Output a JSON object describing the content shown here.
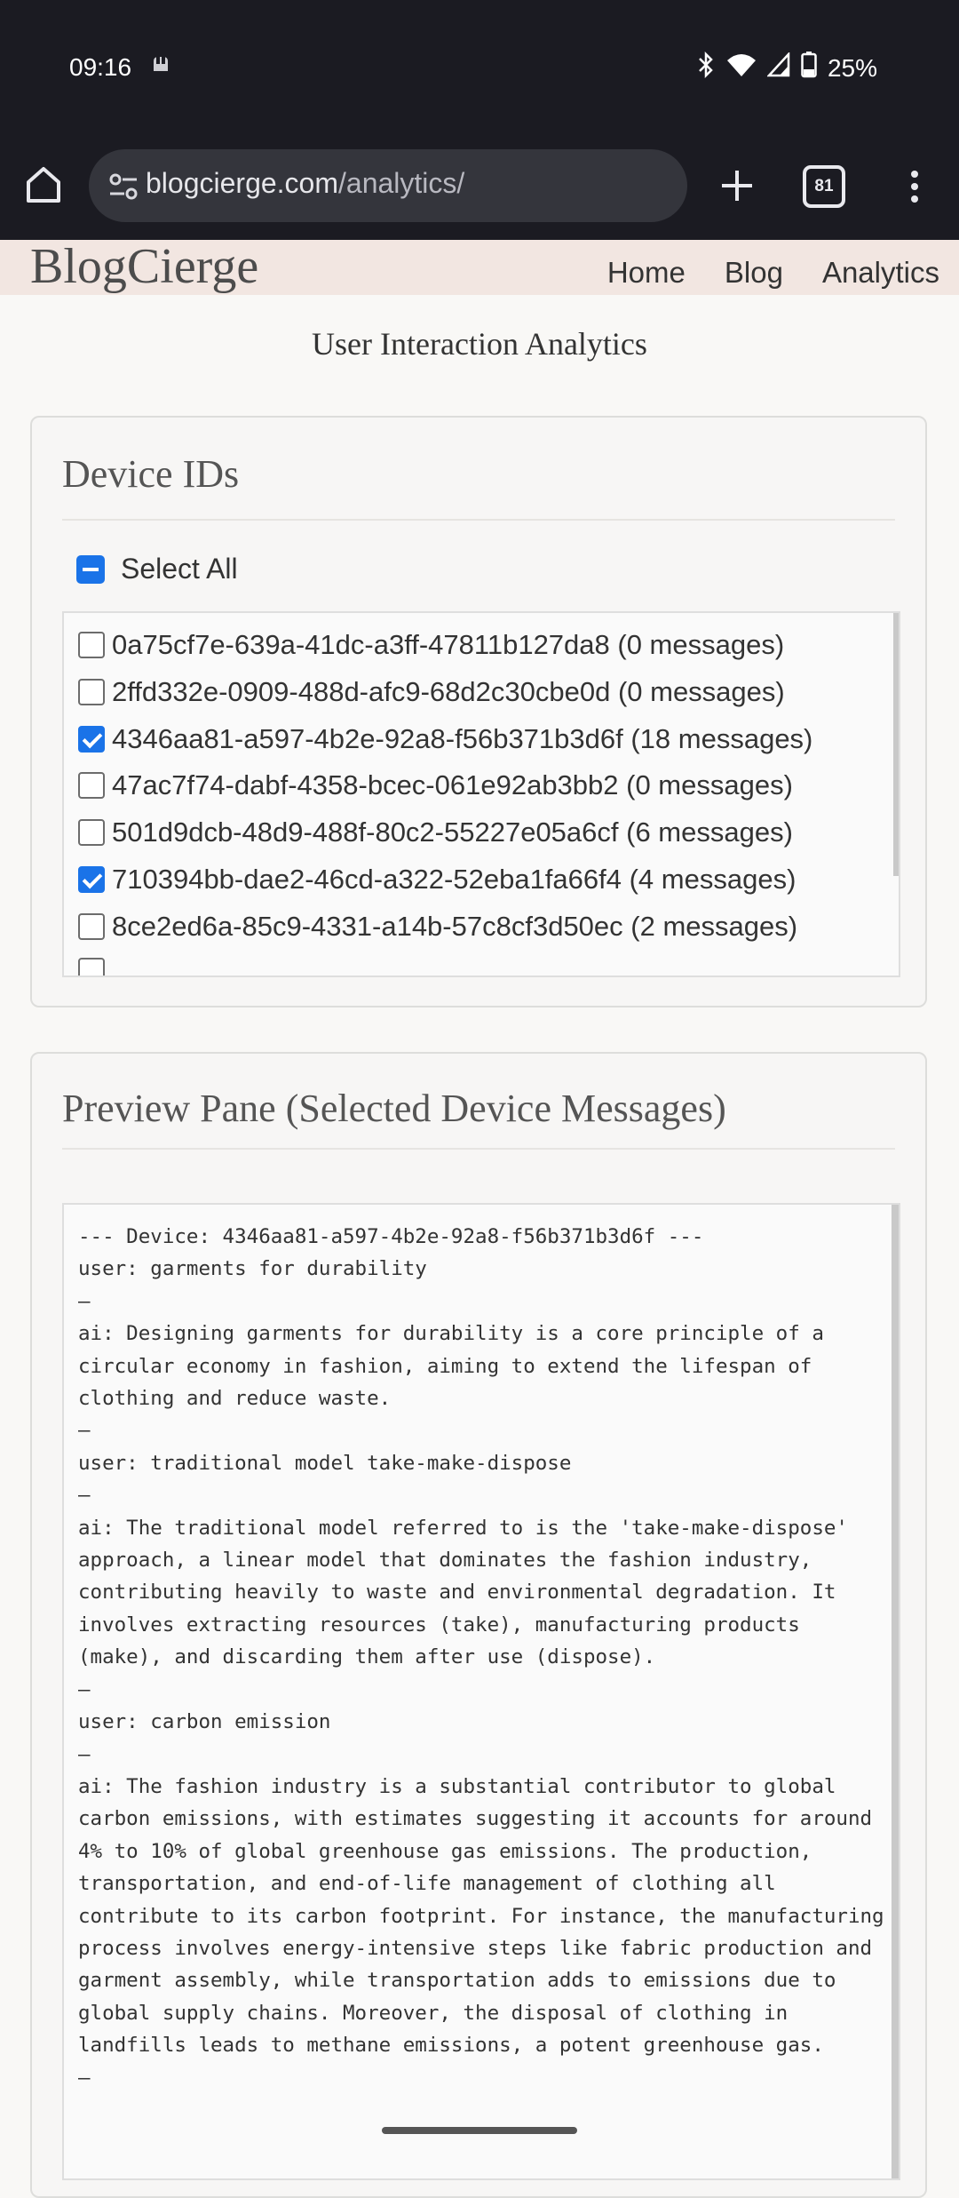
{
  "status_bar": {
    "time": "09:16",
    "battery": "25%",
    "icons": [
      "notification-icon",
      "bluetooth-icon",
      "wifi-icon",
      "signal-icon",
      "battery-icon"
    ]
  },
  "browser": {
    "url_host": "blogcierge.com",
    "url_path": "/analytics/",
    "tab_count": "81"
  },
  "site": {
    "brand": "BlogCierge",
    "nav": [
      "Home",
      "Blog",
      "Analytics"
    ]
  },
  "page": {
    "title": "User Interaction Analytics"
  },
  "devices": {
    "heading": "Device IDs",
    "select_all_label": "Select All",
    "select_all_state": "indeterminate",
    "items": [
      {
        "label": "0a75cf7e-639a-41dc-a3ff-47811b127da8 (0 messages)",
        "checked": false
      },
      {
        "label": "2ffd332e-0909-488d-afc9-68d2c30cbe0d (0 messages)",
        "checked": false
      },
      {
        "label": "4346aa81-a597-4b2e-92a8-f56b371b3d6f (18 messages)",
        "checked": true
      },
      {
        "label": "47ac7f74-dabf-4358-bcec-061e92ab3bb2 (0 messages)",
        "checked": false
      },
      {
        "label": "501d9dcb-48d9-488f-80c2-55227e05a6cf (6 messages)",
        "checked": false
      },
      {
        "label": "710394bb-dae2-46cd-a322-52eba1fa66f4 (4 messages)",
        "checked": true
      },
      {
        "label": "8ce2ed6a-85c9-4331-a14b-57c8cf3d50ec (2 messages)",
        "checked": false
      }
    ]
  },
  "preview": {
    "heading": "Preview Pane (Selected Device Messages)",
    "text": "--- Device: 4346aa81-a597-4b2e-92a8-f56b371b3d6f ---\nuser: garments for durability\n—\nai: Designing garments for durability is a core principle of a circular economy in fashion, aiming to extend the lifespan of clothing and reduce waste.\n—\nuser: traditional model take-make-dispose\n—\nai: The traditional model referred to is the 'take-make-dispose' approach, a linear model that dominates the fashion industry, contributing heavily to waste and environmental degradation. It involves extracting resources (take), manufacturing products (make), and discarding them after use (dispose).\n—\nuser: carbon emission\n—\nai: The fashion industry is a substantial contributor to global carbon emissions, with estimates suggesting it accounts for around 4% to 10% of global greenhouse gas emissions. The production, transportation, and end-of-life management of clothing all contribute to its carbon footprint. For instance, the manufacturing process involves energy-intensive steps like fabric production and garment assembly, while transportation adds to emissions due to global supply chains. Moreover, the disposal of clothing in landfills leads to methane emissions, a potent greenhouse gas.\n—"
  }
}
